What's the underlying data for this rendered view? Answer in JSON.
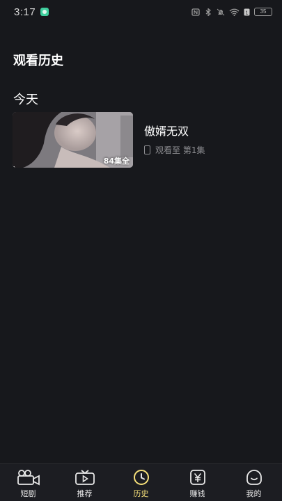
{
  "status_bar": {
    "time": "3:17",
    "battery": "35",
    "icons": [
      "app-notification-icon",
      "nfc-icon",
      "bluetooth-icon",
      "mute-icon",
      "wifi-icon",
      "sim-icon",
      "battery-icon"
    ]
  },
  "header": {
    "title": "观看历史"
  },
  "sections": [
    {
      "label": "今天",
      "items": [
        {
          "title": "傲婿无双",
          "progress_text": "观看至 第1集",
          "episodes_badge": "84集全",
          "watch_progress": 0.02
        }
      ]
    }
  ],
  "tab_bar": {
    "active": "历史",
    "accent_color": "#f6e07a",
    "tabs": [
      {
        "label": "短剧",
        "icon": "film-camera-icon"
      },
      {
        "label": "推荐",
        "icon": "tv-play-icon"
      },
      {
        "label": "历史",
        "icon": "clock-icon"
      },
      {
        "label": "赚钱",
        "icon": "yen-icon"
      },
      {
        "label": "我的",
        "icon": "smile-face-icon"
      }
    ]
  }
}
